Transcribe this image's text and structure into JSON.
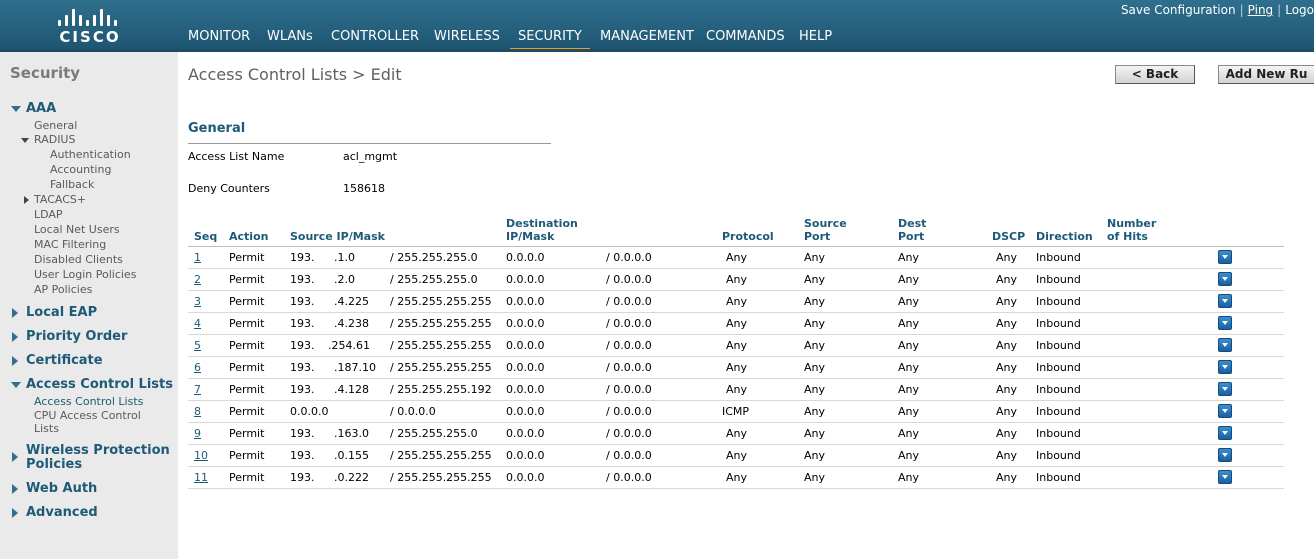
{
  "header": {
    "brand": "CISCO",
    "nav": [
      {
        "label": "MONITOR",
        "active": false
      },
      {
        "label": "WLANs",
        "active": false
      },
      {
        "label": "CONTROLLER",
        "active": false
      },
      {
        "label": "WIRELESS",
        "active": false
      },
      {
        "label": "SECURITY",
        "active": true
      },
      {
        "label": "MANAGEMENT",
        "active": false
      },
      {
        "label": "COMMANDS",
        "active": false
      },
      {
        "label": "HELP",
        "active": false
      }
    ],
    "links": {
      "save": "Save Configuration",
      "ping": "Ping",
      "logout": "Logo"
    },
    "colors": {
      "bar": "#2f6f8e",
      "active_underline": "#f29a2e"
    }
  },
  "sidebar": {
    "title": "Security",
    "aaa": {
      "label": "AAA",
      "general": "General",
      "radius": "RADIUS",
      "radius_items": [
        "Authentication",
        "Accounting",
        "Fallback"
      ],
      "tacacs": "TACACS+",
      "items": [
        "LDAP",
        "Local Net Users",
        "MAC Filtering",
        "Disabled Clients",
        "User Login Policies",
        "AP Policies"
      ]
    },
    "local_eap": "Local EAP",
    "priority_order": "Priority Order",
    "certificate": "Certificate",
    "acl": {
      "label": "Access Control Lists",
      "items": [
        "Access Control Lists",
        "CPU Access Control",
        "Lists"
      ]
    },
    "wireless_protection": [
      "Wireless Protection",
      "Policies"
    ],
    "web_auth": "Web Auth",
    "advanced": "Advanced"
  },
  "main": {
    "title": "Access Control Lists > Edit",
    "back_button": "< Back",
    "add_rule_button": "Add New Ru",
    "section": "General",
    "acl_name_label": "Access List Name",
    "acl_name_value": "acl_mgmt",
    "deny_label": "Deny Counters",
    "deny_value": "158618",
    "table": {
      "headers": {
        "seq": "Seq",
        "action": "Action",
        "source": "Source IP/Mask",
        "dest_top": "Destination",
        "dest_bottom": "IP/Mask",
        "protocol": "Protocol",
        "sport_top": "Source",
        "sport_bottom": "Port",
        "dport_top": "Dest",
        "dport_bottom": "Port",
        "dscp": "DSCP",
        "direction": "Direction",
        "hits_top": "Number",
        "hits_bottom": "of Hits"
      },
      "rows": [
        {
          "seq": "1",
          "action": "Permit",
          "src_ip": "193.",
          "src_tail": ".1.0",
          "src_mask": "/ 255.255.255.0",
          "dst_ip": "0.0.0.0",
          "dst_mask": "/ 0.0.0.0",
          "protocol": "Any",
          "sport": "Any",
          "dport": "Any",
          "dscp": "Any",
          "direction": "Inbound",
          "hits": ""
        },
        {
          "seq": "2",
          "action": "Permit",
          "src_ip": "193.",
          "src_tail": ".2.0",
          "src_mask": "/ 255.255.255.0",
          "dst_ip": "0.0.0.0",
          "dst_mask": "/ 0.0.0.0",
          "protocol": "Any",
          "sport": "Any",
          "dport": "Any",
          "dscp": "Any",
          "direction": "Inbound",
          "hits": ""
        },
        {
          "seq": "3",
          "action": "Permit",
          "src_ip": "193.",
          "src_tail": ".4.225",
          "src_mask": "/ 255.255.255.255",
          "dst_ip": "0.0.0.0",
          "dst_mask": "/ 0.0.0.0",
          "protocol": "Any",
          "sport": "Any",
          "dport": "Any",
          "dscp": "Any",
          "direction": "Inbound",
          "hits": ""
        },
        {
          "seq": "4",
          "action": "Permit",
          "src_ip": "193.",
          "src_tail": ".4.238",
          "src_mask": "/ 255.255.255.255",
          "dst_ip": "0.0.0.0",
          "dst_mask": "/ 0.0.0.0",
          "protocol": "Any",
          "sport": "Any",
          "dport": "Any",
          "dscp": "Any",
          "direction": "Inbound",
          "hits": ""
        },
        {
          "seq": "5",
          "action": "Permit",
          "src_ip": "193.",
          "src_tail": ".254.61",
          "src_mask": "/ 255.255.255.255",
          "dst_ip": "0.0.0.0",
          "dst_mask": "/ 0.0.0.0",
          "protocol": "Any",
          "sport": "Any",
          "dport": "Any",
          "dscp": "Any",
          "direction": "Inbound",
          "hits": ""
        },
        {
          "seq": "6",
          "action": "Permit",
          "src_ip": "193.",
          "src_tail": ".187.10",
          "src_mask": "/ 255.255.255.255",
          "dst_ip": "0.0.0.0",
          "dst_mask": "/ 0.0.0.0",
          "protocol": "Any",
          "sport": "Any",
          "dport": "Any",
          "dscp": "Any",
          "direction": "Inbound",
          "hits": ""
        },
        {
          "seq": "7",
          "action": "Permit",
          "src_ip": "193.",
          "src_tail": ".4.128",
          "src_mask": "/ 255.255.255.192",
          "dst_ip": "0.0.0.0",
          "dst_mask": "/ 0.0.0.0",
          "protocol": "Any",
          "sport": "Any",
          "dport": "Any",
          "dscp": "Any",
          "direction": "Inbound",
          "hits": ""
        },
        {
          "seq": "8",
          "action": "Permit",
          "src_ip": "0.0.0.0",
          "src_tail": "",
          "src_mask": "/ 0.0.0.0",
          "dst_ip": "0.0.0.0",
          "dst_mask": "/ 0.0.0.0",
          "protocol": "ICMP",
          "sport": "Any",
          "dport": "Any",
          "dscp": "Any",
          "direction": "Inbound",
          "hits": ""
        },
        {
          "seq": "9",
          "action": "Permit",
          "src_ip": "193.",
          "src_tail": ".163.0",
          "src_mask": "/ 255.255.255.0",
          "dst_ip": "0.0.0.0",
          "dst_mask": "/ 0.0.0.0",
          "protocol": "Any",
          "sport": "Any",
          "dport": "Any",
          "dscp": "Any",
          "direction": "Inbound",
          "hits": ""
        },
        {
          "seq": "10",
          "action": "Permit",
          "src_ip": "193.",
          "src_tail": ".0.155",
          "src_mask": "/ 255.255.255.255",
          "dst_ip": "0.0.0.0",
          "dst_mask": "/ 0.0.0.0",
          "protocol": "Any",
          "sport": "Any",
          "dport": "Any",
          "dscp": "Any",
          "direction": "Inbound",
          "hits": ""
        },
        {
          "seq": "11",
          "action": "Permit",
          "src_ip": "193.",
          "src_tail": ".0.222",
          "src_mask": "/ 255.255.255.255",
          "dst_ip": "0.0.0.0",
          "dst_mask": "/ 0.0.0.0",
          "protocol": "Any",
          "sport": "Any",
          "dport": "Any",
          "dscp": "Any",
          "direction": "Inbound",
          "hits": ""
        }
      ],
      "row_menu_icon": "dropdown-arrow-icon"
    }
  }
}
